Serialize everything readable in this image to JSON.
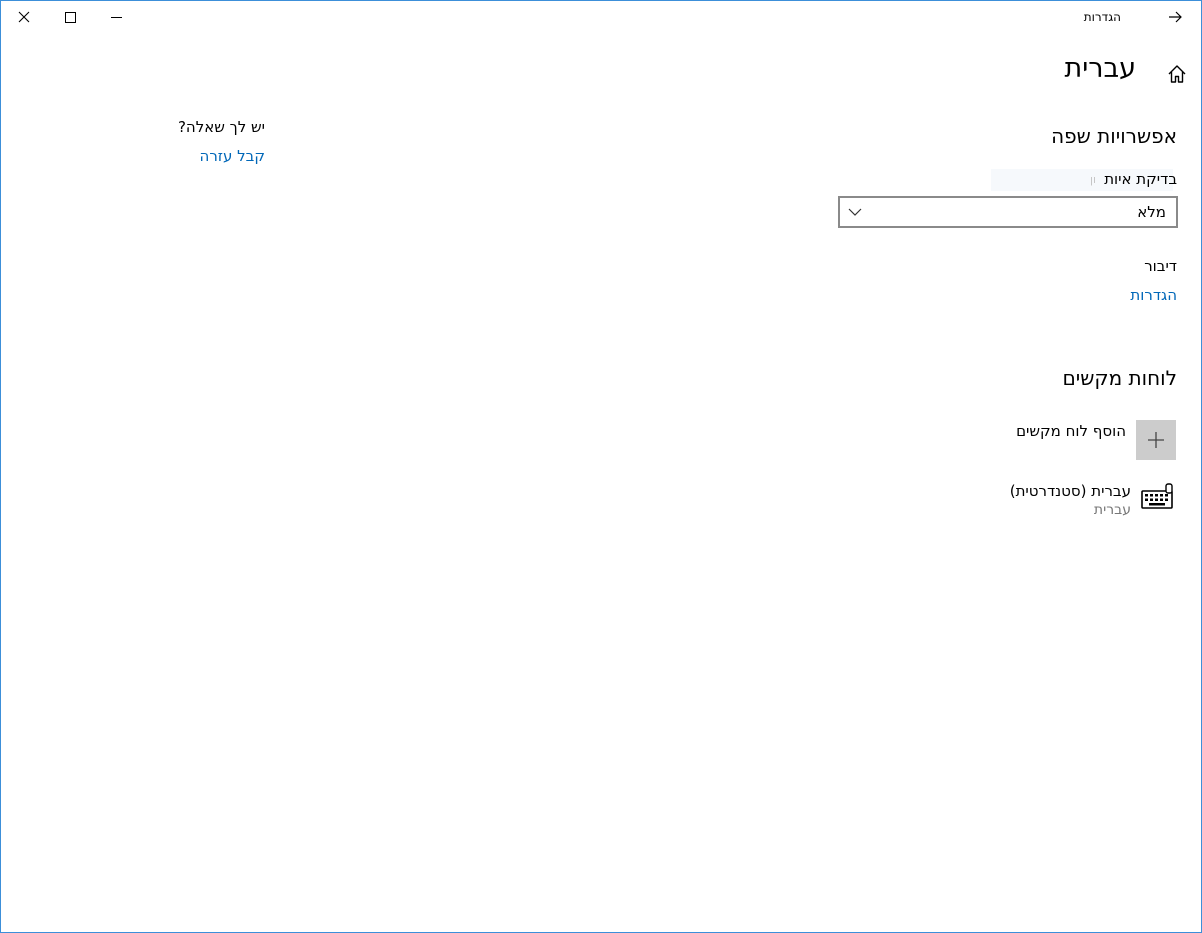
{
  "window": {
    "title": "הגדרות"
  },
  "page": {
    "title": "עברית"
  },
  "language_options": {
    "heading": "אפשרויות שפה",
    "spellcheck_label": "בדיקת איות",
    "spellcheck_value": "מלא",
    "spellcheck_hint": "ון",
    "speech_label": "דיבור",
    "speech_link": "הגדרות"
  },
  "keyboards": {
    "heading": "לוחות מקשים",
    "add_label": "הוסף לוח מקשים",
    "items": [
      {
        "name": "עברית (סטנדרטית)",
        "subtitle": "עברית"
      }
    ]
  },
  "help": {
    "question": "יש לך שאלה?",
    "link": "קבל עזרה"
  },
  "colors": {
    "accent": "#0067b8",
    "border": "#3c8fd9",
    "tile": "#cccccc"
  }
}
